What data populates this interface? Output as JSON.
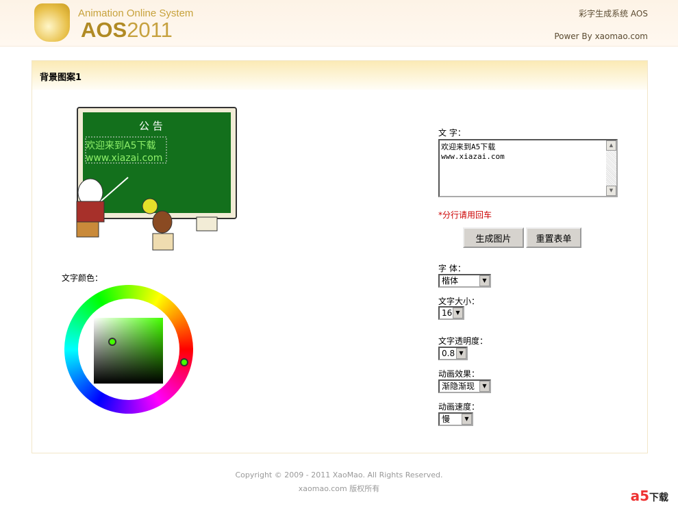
{
  "header": {
    "logo_sub": "Animation Online System",
    "logo_main": "AOS",
    "logo_year": "2011",
    "site_link": "彩字生成系统  AOS",
    "power": "Power By xaomao.com"
  },
  "panel": {
    "title": "背景图案1",
    "board": {
      "title": "公 告",
      "line1": "欢迎来到A5下载",
      "line2": "www.xiazai.com"
    },
    "color_label": "文字颜色：",
    "text_label": "文  字：",
    "text_value": "欢迎来到A5下载\nwww.xiazai.com",
    "hint": "*分行请用回车",
    "generate_button": "生成图片",
    "reset_button": "重置表单",
    "font_label": "字  体：",
    "font_value": "楷体",
    "size_label": "文字大小：",
    "size_value": "16",
    "opacity_label": "文字透明度：",
    "opacity_value": "0.8",
    "effect_label": "动画效果：",
    "effect_value": "渐隐渐现",
    "speed_label": "动画速度：",
    "speed_value": "慢"
  },
  "footer": {
    "copyright": "Copyright © 2009 - 2011 XaoMao. All Rights Reserved.",
    "rights": "xaomao.com 版权所有"
  },
  "watermark": {
    "brand": "a5",
    "text": "下载"
  }
}
